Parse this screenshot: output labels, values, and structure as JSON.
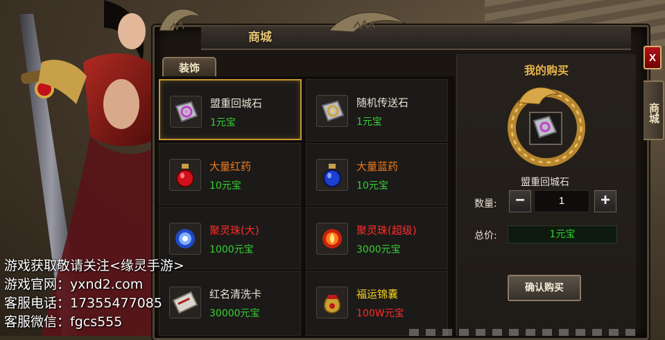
{
  "window": {
    "title": "商城",
    "close_label": "X"
  },
  "side_tab": {
    "label": "商城"
  },
  "category_tab": {
    "label": "装饰"
  },
  "items": [
    {
      "name": "盟重回城石",
      "price": "1元宝",
      "icon": "return-stone-icon",
      "name_color": "#e8e2d6",
      "selected": true
    },
    {
      "name": "随机传送石",
      "price": "1元宝",
      "icon": "teleport-stone-icon",
      "name_color": "#e8e2d6"
    },
    {
      "name": "大量红药",
      "price": "10元宝",
      "icon": "red-potion-icon",
      "name_color": "#ef7b1c"
    },
    {
      "name": "大量蓝药",
      "price": "10元宝",
      "icon": "blue-potion-icon",
      "name_color": "#ef7b1c"
    },
    {
      "name": "聚灵珠(大)",
      "price": "1000元宝",
      "icon": "blue-orb-icon",
      "name_color": "#ff2b2b"
    },
    {
      "name": "聚灵珠(超级)",
      "price": "3000元宝",
      "icon": "fire-orb-icon",
      "name_color": "#ff2b2b"
    },
    {
      "name": "红名清洗卡",
      "price": "30000元宝",
      "icon": "card-icon",
      "name_color": "#e8e2d6"
    },
    {
      "name": "福运锦囊",
      "price": "100W元宝",
      "icon": "lucky-bag-icon",
      "name_color": "#f0d020",
      "price_color": "#ff2b2b"
    }
  ],
  "purchase": {
    "title": "我的购买",
    "item_name": "盟重回城石",
    "quantity_label": "数量:",
    "quantity": "1",
    "total_label": "总价:",
    "total": "1元宝",
    "confirm_label": "确认购买",
    "minus_label": "−",
    "plus_label": "+"
  },
  "overlay_lines": [
    "游戏获取敬请关注<缘灵手游>",
    "游戏官网：yxnd2.com",
    "客服电话：17355477085",
    "客服微信：fgcs555"
  ],
  "colors": {
    "accent_gold": "#c99733",
    "price_green": "#34d233",
    "close_red": "#b4121a"
  }
}
